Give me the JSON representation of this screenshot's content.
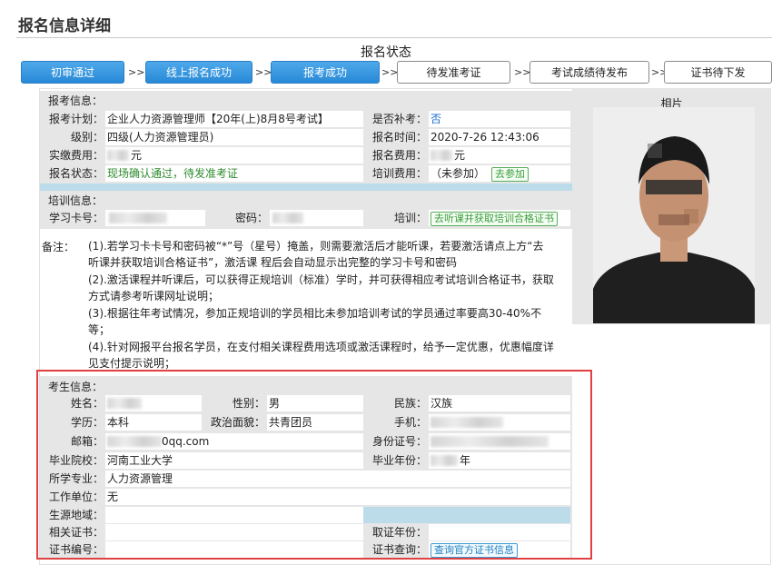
{
  "page": {
    "title": "报名信息详细"
  },
  "status": {
    "title": "报名状态",
    "steps": [
      {
        "label": "初审通过",
        "done": true
      },
      {
        "label": "线上报名成功",
        "done": true
      },
      {
        "label": "报考成功",
        "done": true
      },
      {
        "label": "待发准考证",
        "done": false
      },
      {
        "label": "考试成绩待发布",
        "done": false
      },
      {
        "label": "证书待下发",
        "done": false
      }
    ],
    "arrow": ">>"
  },
  "exam": {
    "section_label": "报考信息：",
    "plan_label": "报考计划：",
    "plan_value": "企业人力资源管理师【20年(上)8月8号考试】",
    "level_label": "级别：",
    "level_value": "四级(人力资源管理员)",
    "paid_label": "实缴费用：",
    "paid_value": "元",
    "state_label": "报名状态：",
    "state_value": "现场确认通过，待发准考证",
    "makeup_label": "是否补考：",
    "makeup_value": "否",
    "time_label": "报名时间：",
    "time_value": "2020-7-26 12:43:06",
    "fee_label": "报名费用：",
    "fee_value": "元",
    "train_fee_label": "培训费用：",
    "train_fee_value": "（未参加）",
    "train_fee_button": "去参加"
  },
  "training": {
    "section_label": "培训信息：",
    "card_label": "学习卡号：",
    "password_label": "密码：",
    "train_label": "培训：",
    "train_button": "去听课并获取培训合格证书"
  },
  "notes": {
    "label": "备注：",
    "lines": [
      "(1).若学习卡卡号和密码被“*”号（星号）掩盖，则需要激活后才能听课，若要激活请点上方“去",
      "听课并获取培训合格证书”，激活课 程后会自动显示出完整的学习卡号和密码",
      "(2).激活课程并听课后，可以获得正规培训（标准）学时，并可获得相应考试培训合格证书，获取",
      "方式请参考听课网址说明；",
      "(3).根据往年考试情况，参加正规培训的学员相比未参加培训考试的学员通过率要高30-40%不",
      "等；",
      "(4).针对网报平台报名学员，在支付相关课程费用选项或激活课程时，给予一定优惠，优惠幅度详",
      "见支付提示说明；"
    ]
  },
  "photo": {
    "label": "相片"
  },
  "candidate": {
    "section_label": "考生信息：",
    "name_label": "姓名：",
    "gender_label": "性别：",
    "gender_value": "男",
    "ethnicity_label": "民族：",
    "ethnicity_value": "汉族",
    "education_label": "学历：",
    "education_value": "本科",
    "political_label": "政治面貌：",
    "political_value": "共青团员",
    "phone_label": "手机：",
    "email_label": "邮箱：",
    "email_value": "0qq.com",
    "id_label": "身份证号：",
    "school_label": "毕业院校：",
    "school_value": "河南工业大学",
    "grad_year_label": "毕业年份：",
    "grad_year_suffix": "年",
    "major_label": "所学专业：",
    "major_value": "人力资源管理",
    "employer_label": "工作单位：",
    "employer_value": "无",
    "origin_label": "生源地域：",
    "cert_label": "相关证书：",
    "cert_year_label": "取证年份：",
    "cert_no_label": "证书编号：",
    "cert_query_label": "证书查询：",
    "cert_query_button": "查询官方证书信息"
  }
}
